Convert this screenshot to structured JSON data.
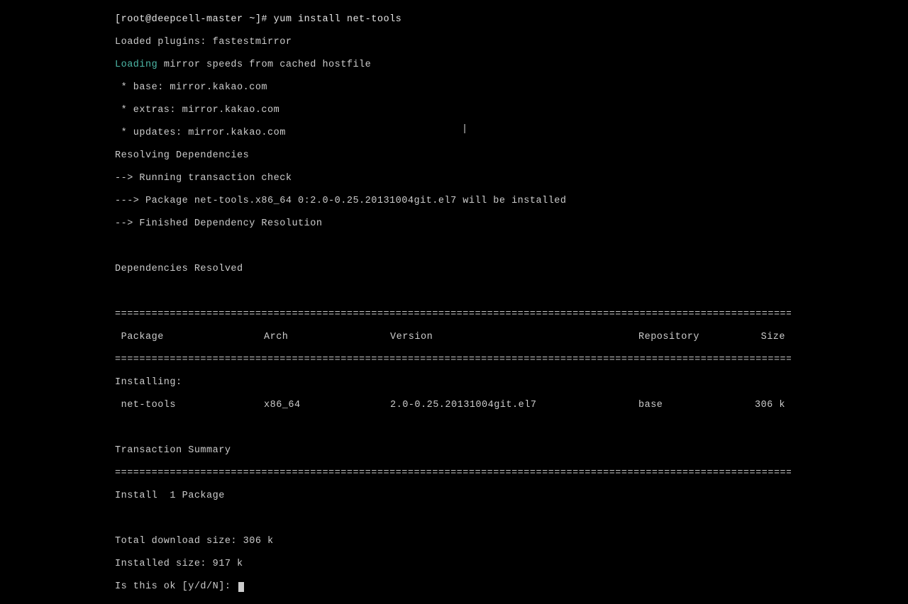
{
  "prompt": {
    "user": "[root@deepcell-master ~]# ",
    "command": "yum install net-tools"
  },
  "lines": {
    "plugins": "Loaded plugins: fastestmirror",
    "loading_prefix": "Loading",
    "loading_suffix": " mirror speeds from cached hostfile",
    "mirror_base": " * base: mirror.kakao.com",
    "mirror_extras": " * extras: mirror.kakao.com",
    "mirror_updates": " * updates: mirror.kakao.com",
    "resolving": "Resolving Dependencies",
    "running_check": "--> Running transaction check",
    "package_line": "---> Package net-tools.x86_64 0:2.0-0.25.20131004git.el7 will be installed",
    "finished": "--> Finished Dependency Resolution",
    "deps_resolved": "Dependencies Resolved",
    "installing": "Installing:",
    "trans_summary": "Transaction Summary",
    "install_count": "Install  1 Package",
    "download_size": "Total download size: 306 k",
    "installed_size": "Installed size: 917 k",
    "confirm": "Is this ok [y/d/N]: "
  },
  "table": {
    "headers": {
      "package": " Package",
      "arch": "Arch",
      "version": "Version",
      "repository": "Repository",
      "size": "Size"
    },
    "row": {
      "package": " net-tools",
      "arch": "x86_64",
      "version": "2.0-0.25.20131004git.el7",
      "repository": "base",
      "size": "306 k"
    }
  },
  "divider": "================================================================================================================================================="
}
